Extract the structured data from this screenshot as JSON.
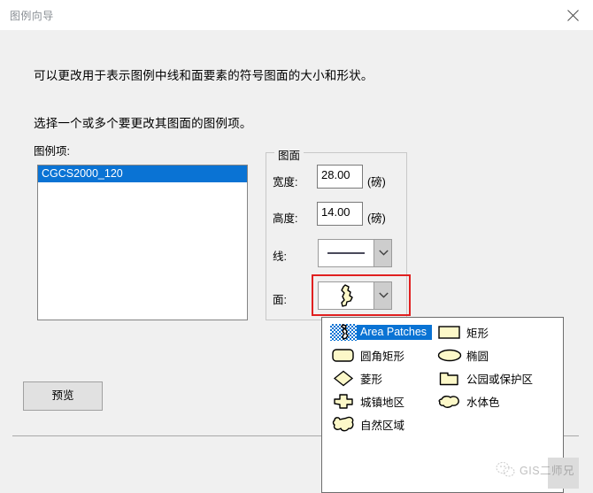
{
  "window": {
    "title": "图例向导",
    "close_icon": "close-icon"
  },
  "description": {
    "line1": "可以更改用于表示图例中线和面要素的符号图面的大小和形状。",
    "line2": "选择一个或多个要更改其图面的图例项。"
  },
  "legend_items": {
    "label": "图例项:",
    "items": [
      {
        "name": "CGCS2000_120",
        "selected": true
      }
    ]
  },
  "patch_group": {
    "title": "图面",
    "width": {
      "label": "宽度:",
      "value": "28.00",
      "unit": "(磅)"
    },
    "height": {
      "label": "高度:",
      "value": "14.00",
      "unit": "(磅)"
    },
    "line": {
      "label": "线:",
      "value": "",
      "icon": "line-swatch-icon"
    },
    "polygon": {
      "label": "面:",
      "value": "",
      "icon": "area-patch-icon"
    }
  },
  "buttons": {
    "preview": "预览"
  },
  "dropdown": {
    "open": true,
    "selected": "Area Patches",
    "column_left": [
      {
        "label": "Area Patches",
        "icon": "area-patch-icon",
        "selected": true
      },
      {
        "label": "圆角矩形",
        "icon": "rounded-rect-icon",
        "selected": false
      },
      {
        "label": "菱形",
        "icon": "diamond-icon",
        "selected": false
      },
      {
        "label": "城镇地区",
        "icon": "urban-area-icon",
        "selected": false
      },
      {
        "label": "自然区域",
        "icon": "natural-area-icon",
        "selected": false
      }
    ],
    "column_right": [
      {
        "label": "矩形",
        "icon": "rectangle-icon",
        "selected": false
      },
      {
        "label": "椭圆",
        "icon": "ellipse-icon",
        "selected": false
      },
      {
        "label": "公园或保护区",
        "icon": "park-icon",
        "selected": false
      },
      {
        "label": "水体色",
        "icon": "water-body-icon",
        "selected": false
      }
    ]
  },
  "watermark": {
    "text": "GIS二师兄",
    "icon": "wechat-icon"
  },
  "colors": {
    "selection_blue": "#0a73d4",
    "highlight_red": "#e02020",
    "patch_fill": "#fcf8c8",
    "window_bg": "#f0f0f0"
  }
}
